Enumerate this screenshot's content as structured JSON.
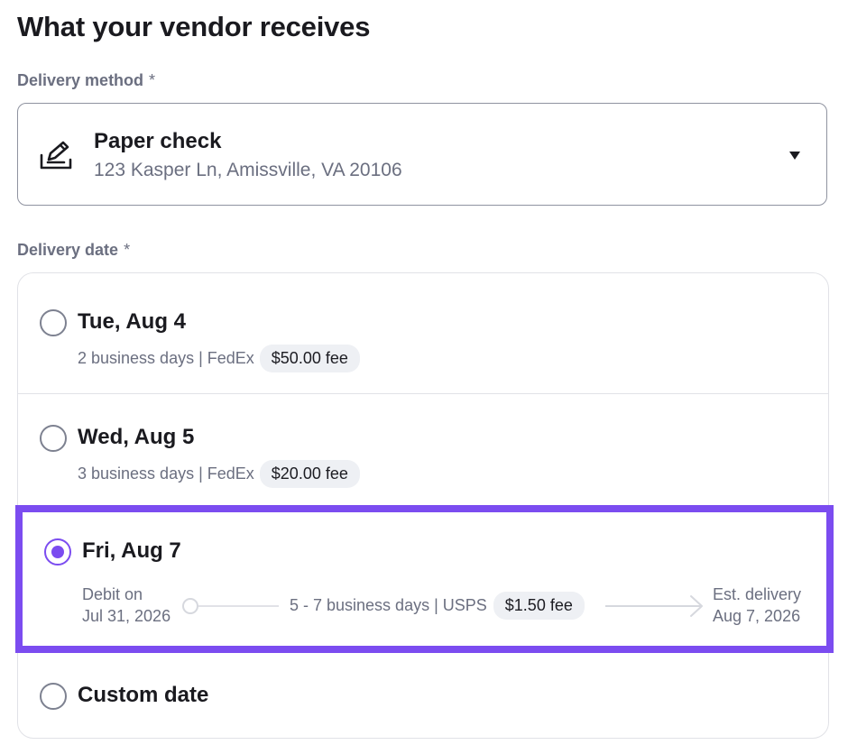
{
  "page": {
    "title": "What your vendor receives"
  },
  "delivery_method": {
    "label": "Delivery method",
    "required_marker": "*",
    "icon": "check-pen-icon",
    "title": "Paper check",
    "address": "123 Kasper Ln, Amissville, VA 20106"
  },
  "delivery_date": {
    "label": "Delivery date",
    "required_marker": "*",
    "options": [
      {
        "date": "Tue, Aug 4",
        "detail": "2 business days | FedEx",
        "fee": "$50.00 fee",
        "selected": false
      },
      {
        "date": "Wed, Aug 5",
        "detail": "3 business days | FedEx",
        "fee": "$20.00 fee",
        "selected": false
      },
      {
        "date": "Fri, Aug 7",
        "selected": true,
        "timeline": {
          "debit_label": "Debit on",
          "debit_date": "Jul 31, 2026",
          "detail": "5 - 7 business days | USPS",
          "fee": "$1.50 fee",
          "delivery_label": "Est. delivery",
          "delivery_date": "Aug 7, 2026"
        }
      },
      {
        "date": "Custom date",
        "selected": false
      }
    ]
  },
  "colors": {
    "accent": "#7b4cf0",
    "label": "#6b6f80",
    "border": "#e1e2e7",
    "fee_pill_bg": "#eef0f4"
  }
}
